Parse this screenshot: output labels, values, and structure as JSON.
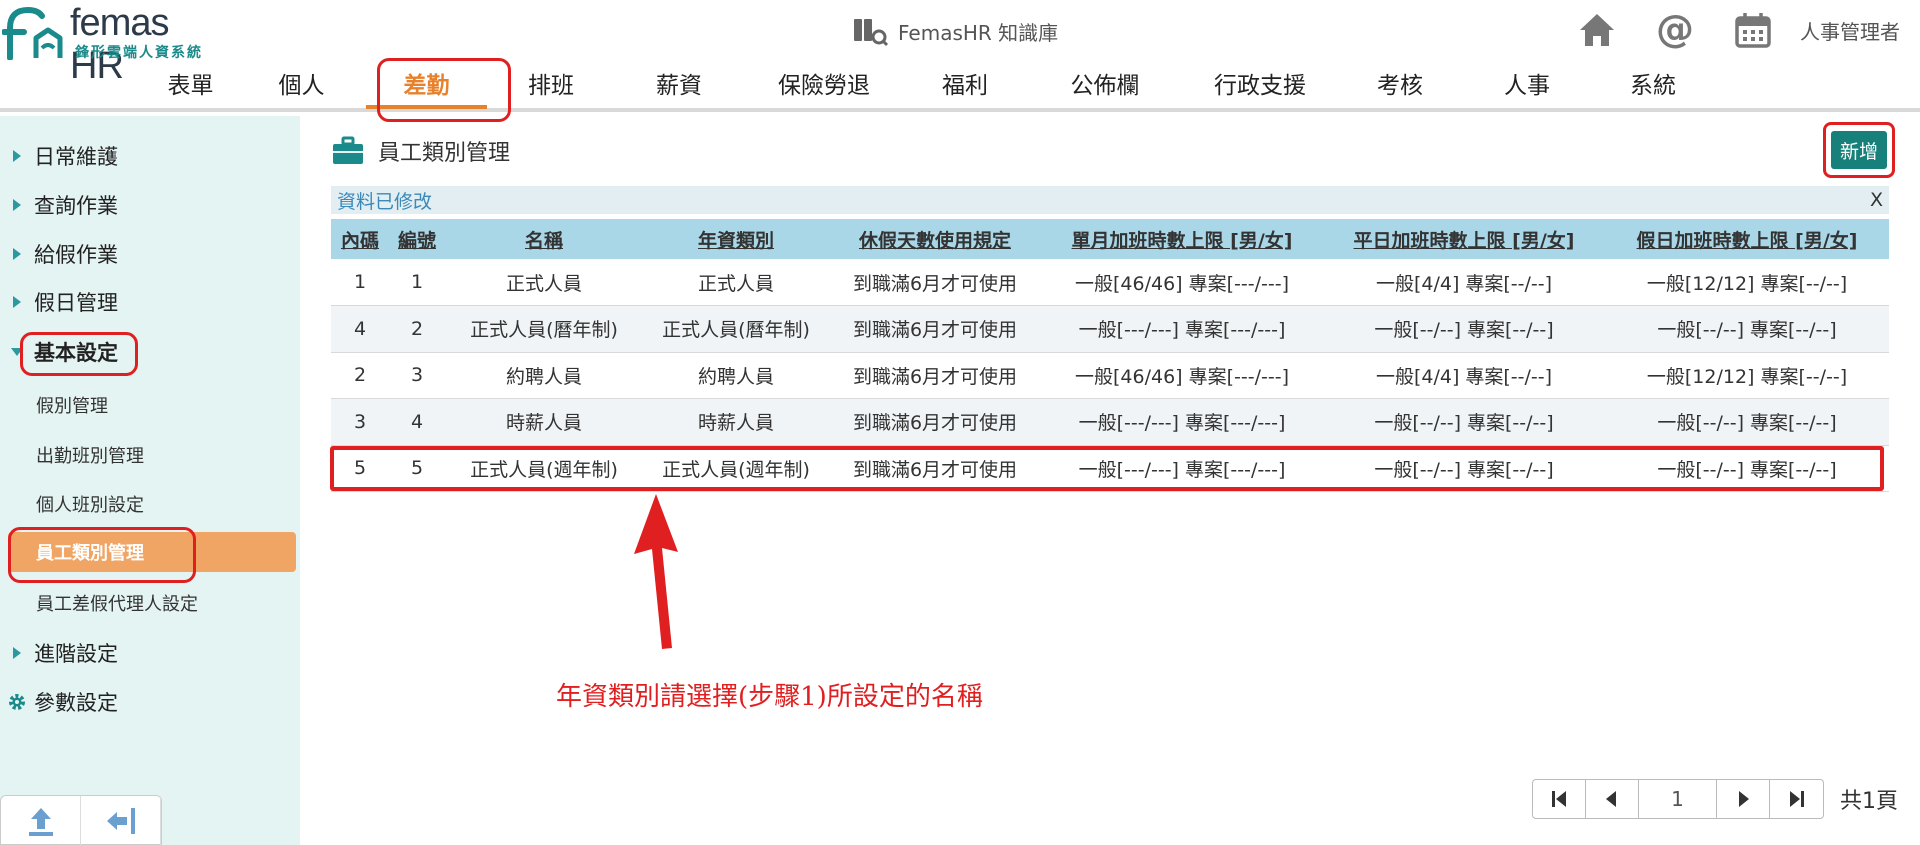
{
  "header": {
    "logo_text": "femas HR",
    "logo_sub": "鋒形雲端人資系統",
    "knowledge_base": "FemasHR 知識庫",
    "user": "人事管理者",
    "icons": [
      "home-icon",
      "at-icon",
      "calendar-icon"
    ]
  },
  "nav": {
    "items": [
      "表單",
      "個人",
      "差勤",
      "排班",
      "薪資",
      "保險勞退",
      "福利",
      "公佈欄",
      "行政支援",
      "考核",
      "人事",
      "系統"
    ],
    "active": "差勤"
  },
  "sidebar": {
    "daily": "日常維護",
    "query": "查詢作業",
    "leave_ops": "給假作業",
    "holiday": "假日管理",
    "basic": "基本設定",
    "sub": [
      "假別管理",
      "出勤班別管理",
      "個人班別設定",
      "員工類別管理",
      "員工差假代理人設定"
    ],
    "active_sub": "員工類別管理",
    "advanced": "進階設定",
    "params": "參數設定"
  },
  "main": {
    "title": "員工類別管理",
    "add_button": "新增",
    "notice": "資料已修改",
    "notice_close": "X",
    "columns": [
      "內碼",
      "編號",
      "名稱",
      "年資類別",
      "休假天數使用規定",
      "單月加班時數上限 [男/女]",
      "平日加班時數上限 [男/女]",
      "假日加班時數上限 [男/女]"
    ],
    "rows": [
      [
        "1",
        "1",
        "正式人員",
        "正式人員",
        "到職滿6月才可使用",
        "一般[46/46] 專案[---/---]",
        "一般[4/4] 專案[--/--]",
        "一般[12/12] 專案[--/--]"
      ],
      [
        "4",
        "2",
        "正式人員(曆年制)",
        "正式人員(曆年制)",
        "到職滿6月才可使用",
        "一般[---/---] 專案[---/---]",
        "一般[--/--] 專案[--/--]",
        "一般[--/--] 專案[--/--]"
      ],
      [
        "2",
        "3",
        "約聘人員",
        "約聘人員",
        "到職滿6月才可使用",
        "一般[46/46] 專案[---/---]",
        "一般[4/4] 專案[--/--]",
        "一般[12/12] 專案[--/--]"
      ],
      [
        "3",
        "4",
        "時薪人員",
        "時薪人員",
        "到職滿6月才可使用",
        "一般[---/---] 專案[---/---]",
        "一般[--/--] 專案[--/--]",
        "一般[--/--] 專案[--/--]"
      ],
      [
        "5",
        "5",
        "正式人員(週年制)",
        "正式人員(週年制)",
        "到職滿6月才可使用",
        "一般[---/---] 專案[---/---]",
        "一般[--/--] 專案[--/--]",
        "一般[--/--] 專案[--/--]"
      ]
    ],
    "annotation": "年資類別請選擇(步驟1)所設定的名稱"
  },
  "pager": {
    "page": "1",
    "total": "共1頁"
  },
  "colors": {
    "accent": "#e8812c",
    "teal": "#17807a",
    "header_row": "#a9d7e8",
    "highlight": "#e02020",
    "sidebar_bg": "#e4f4f3"
  }
}
